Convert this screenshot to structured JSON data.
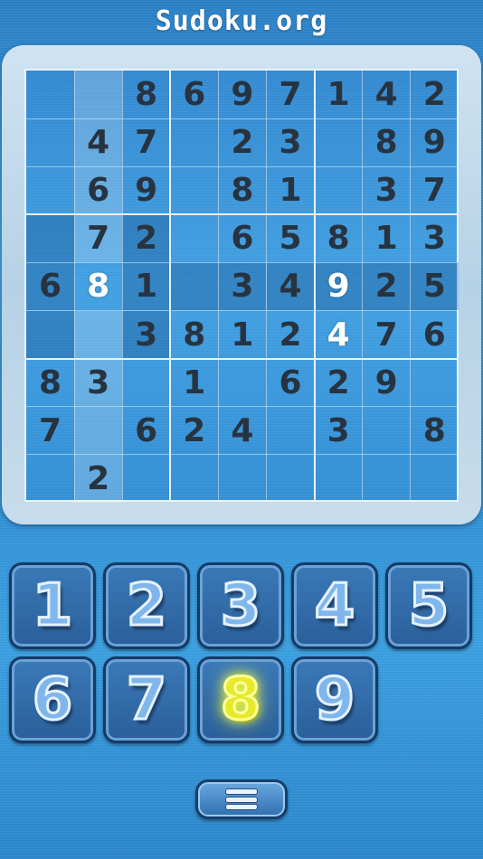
{
  "header": {
    "title": "Sudoku.org"
  },
  "board": {
    "rows": [
      [
        "",
        "",
        "8",
        "6",
        "9",
        "7",
        "1",
        "4",
        "2"
      ],
      [
        "",
        "4",
        "7",
        "",
        "2",
        "3",
        "",
        "8",
        "9"
      ],
      [
        "",
        "6",
        "9",
        "",
        "8",
        "1",
        "",
        "3",
        "7"
      ],
      [
        "",
        "7",
        "2",
        "",
        "6",
        "5",
        "8",
        "1",
        "3"
      ],
      [
        "6",
        "8",
        "1",
        "",
        "3",
        "4",
        "9",
        "2",
        "5"
      ],
      [
        "",
        "",
        "3",
        "8",
        "1",
        "2",
        "4",
        "7",
        "6"
      ],
      [
        "8",
        "3",
        "",
        "1",
        "",
        "6",
        "2",
        "9",
        ""
      ],
      [
        "7",
        "",
        "6",
        "2",
        "4",
        "",
        "3",
        "",
        "8"
      ],
      [
        "",
        "2",
        "",
        "",
        "",
        "",
        "",
        "",
        ""
      ]
    ],
    "highlighted_cells": [
      [
        4,
        1
      ],
      [
        4,
        6
      ],
      [
        5,
        6
      ]
    ],
    "selected_row": 4,
    "selected_col": 1
  },
  "keypad": {
    "keys": [
      "1",
      "2",
      "3",
      "4",
      "5",
      "6",
      "7",
      "8",
      "9"
    ],
    "active_key": "8"
  },
  "menu": {
    "icon": "hamburger-menu-icon"
  },
  "colors": {
    "background": "#2f8dd3",
    "frame": "#c7dcec",
    "digit": "#283340",
    "highlight_digit": "#ffffff",
    "active_key": "#e7e92a"
  }
}
